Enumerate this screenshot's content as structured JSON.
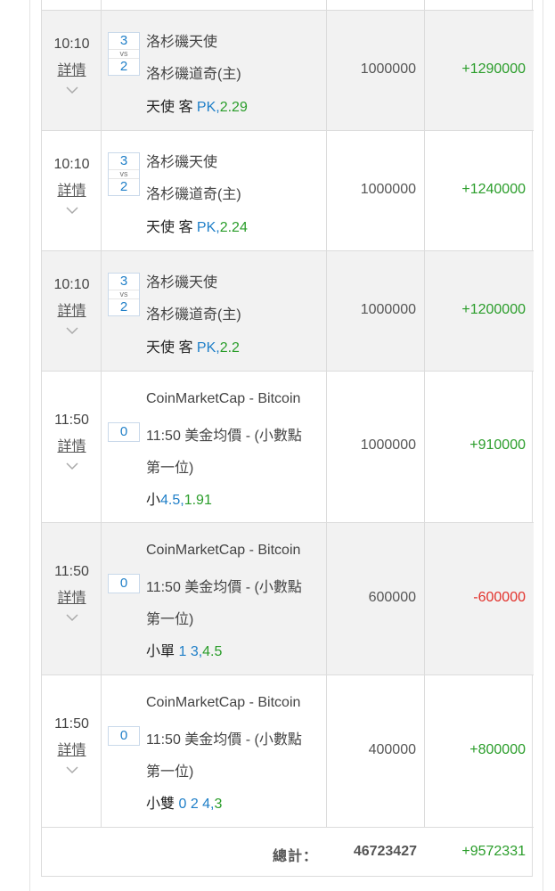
{
  "detail_label": "詳情",
  "vs_label": "vs",
  "rows": [
    {
      "time": "10:10",
      "score_top": "3",
      "score_bottom": "2",
      "team1": "洛杉磯天使",
      "team2": "洛杉磯道奇(主)",
      "pick": "天使 客",
      "pick_detail": "PK,",
      "odds": "2.29",
      "bet": "1000000",
      "win": "+1290000"
    },
    {
      "time": "10:10",
      "score_top": "3",
      "score_bottom": "2",
      "team1": "洛杉磯天使",
      "team2": "洛杉磯道奇(主)",
      "pick": "天使 客",
      "pick_detail": "PK,",
      "odds": "2.24",
      "bet": "1000000",
      "win": "+1240000"
    },
    {
      "time": "10:10",
      "score_top": "3",
      "score_bottom": "2",
      "team1": "洛杉磯天使",
      "team2": "洛杉磯道奇(主)",
      "pick": "天使 客",
      "pick_detail": "PK,",
      "odds": "2.2",
      "bet": "1000000",
      "win": "+1200000"
    },
    {
      "time": "11:50",
      "score": "0",
      "line1": "CoinMarketCap - Bitcoin",
      "line2": "11:50 美金均價 - (小數點",
      "line3": "第一位)",
      "pick": "小",
      "pick_detail": "4.5,",
      "odds": "1.91",
      "bet": "1000000",
      "win": "+910000"
    },
    {
      "time": "11:50",
      "score": "0",
      "line1": "CoinMarketCap - Bitcoin",
      "line2": "11:50 美金均價 - (小數點",
      "line3": "第一位)",
      "pick": "小單",
      "pick_detail": "1 3,",
      "odds": "4.5",
      "bet": "600000",
      "win": "-600000"
    },
    {
      "time": "11:50",
      "score": "0",
      "line1": "CoinMarketCap - Bitcoin",
      "line2": "11:50 美金均價 - (小數點",
      "line3": "第一位)",
      "pick": "小雙",
      "pick_detail": "0 2 4,",
      "odds": "3",
      "bet": "400000",
      "win": "+800000"
    }
  ],
  "totals": {
    "label": "總計：",
    "bet": "46723427",
    "win": "+9572331"
  },
  "colors": {
    "positive": "#2a9d2a",
    "negative": "#e2312b",
    "link_blue": "#1f7fc8"
  }
}
